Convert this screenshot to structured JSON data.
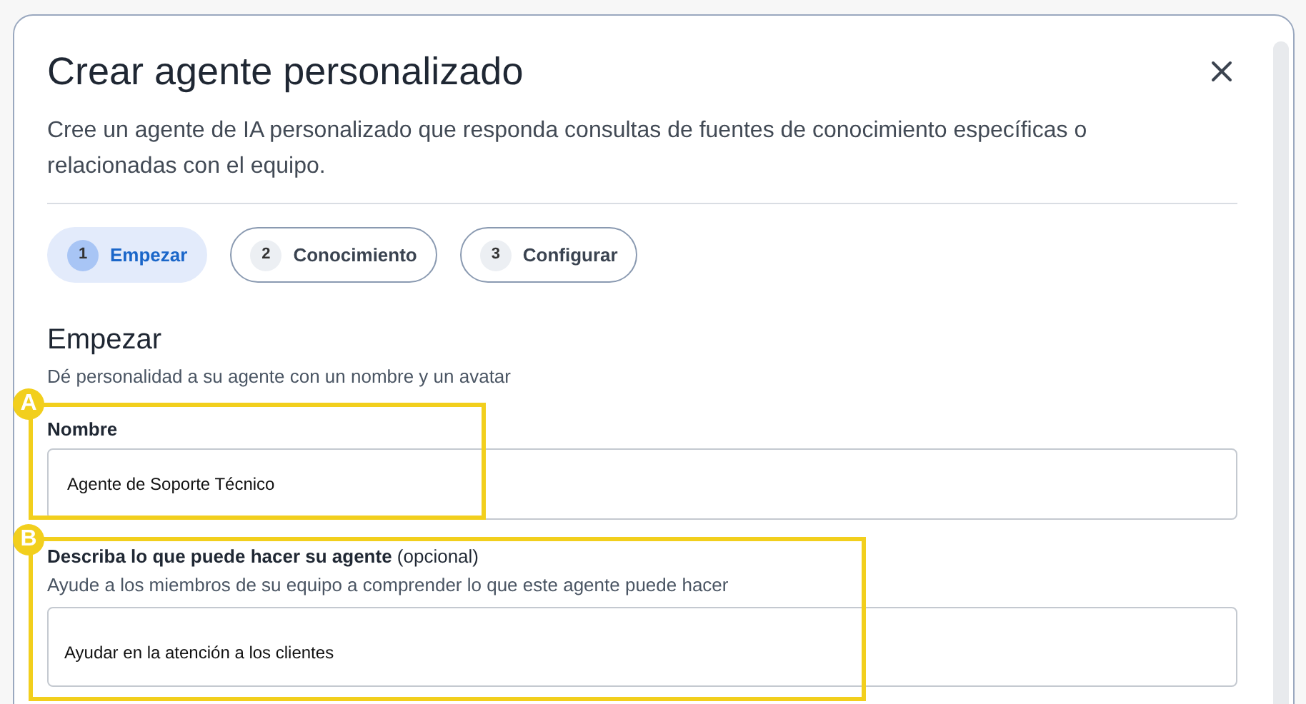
{
  "dialog": {
    "title": "Crear agente personalizado",
    "description": "Cree un agente de IA personalizado que responda consultas de fuentes de conocimiento específicas o relacionadas con el equipo."
  },
  "steps": [
    {
      "number": "1",
      "label": "Empezar",
      "selected": true
    },
    {
      "number": "2",
      "label": "Conocimiento",
      "selected": false
    },
    {
      "number": "3",
      "label": "Configurar",
      "selected": false
    }
  ],
  "section": {
    "heading": "Empezar",
    "subtitle": "Dé personalidad a su agente con un nombre y un avatar"
  },
  "name_field": {
    "label": "Nombre",
    "value": "Agente de Soporte Técnico"
  },
  "description_field": {
    "label": "**Describa lo que puede hacer su agente** (opcional)",
    "help": "Ayude a los miembros de su equipo a comprender lo que este agente puede hacer",
    "value": "Ayudar en la atención a los clientes"
  },
  "callouts": [
    {
      "label": "A"
    },
    {
      "label": "B"
    }
  ]
}
